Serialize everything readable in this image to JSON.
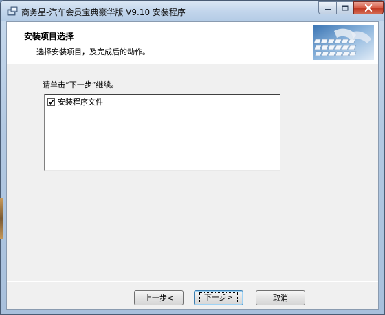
{
  "window": {
    "title": "商务星-汽车会员宝典豪华版 V9.10 安装程序",
    "controls": {
      "minimize": "minimize",
      "maximize": "maximize",
      "close": "close"
    }
  },
  "header": {
    "title": "安装项目选择",
    "subtitle": "选择安装项目，及完成后的动作。"
  },
  "main": {
    "prompt": "请单击“下一步”继续。",
    "components": [
      {
        "label": "安装程序文件",
        "checked": true
      }
    ]
  },
  "buttons": {
    "back": "上一步<",
    "next": "下一步>",
    "cancel": "取消"
  },
  "colors": {
    "titlebar": "#c3d6ec",
    "close_button": "#c13a24",
    "client_background": "#f0f0f0",
    "header_background": "#ffffff",
    "default_button_border": "#3c7fb1"
  }
}
